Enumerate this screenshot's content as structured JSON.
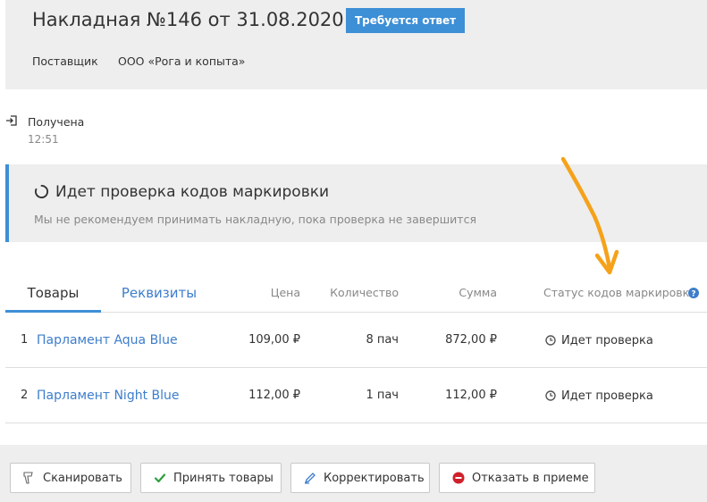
{
  "header": {
    "title": "Накладная №146 от 31.08.2020",
    "badge": "Требуется ответ",
    "supplier_label": "Поставщик",
    "supplier_value": "ООО «Рога и копыта»"
  },
  "received": {
    "label": "Получена",
    "time": "12:51"
  },
  "notice": {
    "title": "Идет проверка кодов маркировки",
    "text": "Мы не рекомендуем принимать накладную, пока проверка не завершится"
  },
  "tabs": [
    {
      "label": "Товары",
      "active": true
    },
    {
      "label": "Реквизиты",
      "active": false
    }
  ],
  "columns": {
    "price": "Цена",
    "quantity": "Количество",
    "sum": "Сумма",
    "status": "Статус кодов маркировки"
  },
  "rows": [
    {
      "num": "1",
      "name": "Парламент Aqua Blue",
      "price": "109,00 ₽",
      "quantity": "8 пач",
      "sum": "872,00 ₽",
      "status": "Идет проверка"
    },
    {
      "num": "2",
      "name": "Парламент Night Blue",
      "price": "112,00 ₽",
      "quantity": "1 пач",
      "sum": "112,00 ₽",
      "status": "Идет проверка"
    }
  ],
  "buttons": {
    "scan": "Сканировать",
    "accept": "Принять товары",
    "correct": "Корректировать",
    "reject": "Отказать в приеме"
  },
  "colors": {
    "accent": "#3d8fd6",
    "link": "#3d7dcc",
    "accept_icon": "#2e9e3e",
    "reject_icon": "#d0202a",
    "annotation_arrow": "#f5a21b"
  },
  "icons": {
    "received": "sign-in-icon",
    "spinner": "spinner-icon",
    "help": "question-circle-icon",
    "status": "clock-icon",
    "scan": "barcode-scanner-icon",
    "accept": "checkmark-icon",
    "correct": "pencil-icon",
    "reject": "minus-circle-icon"
  }
}
